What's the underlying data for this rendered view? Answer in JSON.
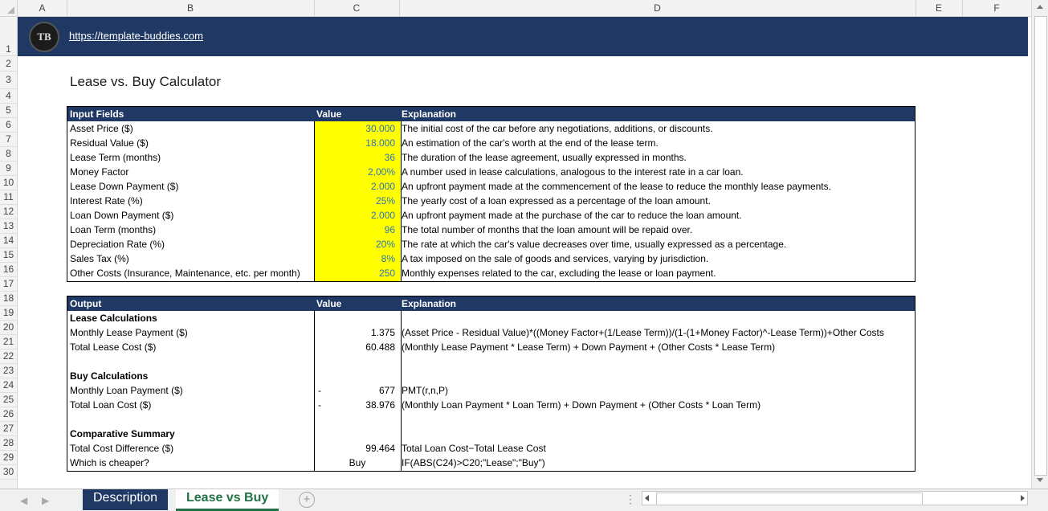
{
  "columns": [
    "A",
    "B",
    "C",
    "D",
    "E",
    "F"
  ],
  "rows": [
    "1",
    "2",
    "3",
    "4",
    "5",
    "6",
    "7",
    "8",
    "9",
    "10",
    "11",
    "12",
    "13",
    "14",
    "15",
    "16",
    "17",
    "18",
    "19",
    "20",
    "21",
    "22",
    "23",
    "24",
    "25",
    "26",
    "27",
    "28",
    "29",
    "30"
  ],
  "header": {
    "logo_text": "TB",
    "link": "https://template-buddies.com"
  },
  "title": "Lease vs. Buy Calculator",
  "input_table": {
    "headers": [
      "Input Fields",
      "Value",
      "Explanation"
    ],
    "rows": [
      {
        "field": "Asset Price ($)",
        "value": "30.000",
        "explanation": "The initial cost of the car before any negotiations, additions, or discounts."
      },
      {
        "field": "Residual Value ($)",
        "value": "18.000",
        "explanation": "An estimation of the car's worth at the end of the lease term."
      },
      {
        "field": "Lease Term (months)",
        "value": "36",
        "explanation": "The duration of the lease agreement, usually expressed in months."
      },
      {
        "field": "Money Factor",
        "value": "2,00%",
        "explanation": "A number used in lease calculations, analogous to the interest rate in a car loan."
      },
      {
        "field": "Lease Down Payment ($)",
        "value": "2.000",
        "explanation": "An upfront payment made at the commencement of the lease to reduce the monthly lease payments."
      },
      {
        "field": "Interest Rate (%)",
        "value": "25%",
        "explanation": "The yearly cost of a loan expressed as a percentage of the loan amount."
      },
      {
        "field": "Loan Down Payment ($)",
        "value": "2.000",
        "explanation": "An upfront payment made at the purchase of the car to reduce the loan amount."
      },
      {
        "field": "Loan Term (months)",
        "value": "96",
        "explanation": "The total number of months that the loan amount will be repaid over."
      },
      {
        "field": "Depreciation Rate (%)",
        "value": "20%",
        "explanation": "The rate at which the car's value decreases over time, usually expressed as a percentage."
      },
      {
        "field": "Sales Tax (%)",
        "value": "8%",
        "explanation": "A tax imposed on the sale of goods and services, varying by jurisdiction."
      },
      {
        "field": "Other Costs (Insurance, Maintenance, etc. per month)",
        "value": "250",
        "explanation": "Monthly expenses related to the car, excluding the lease or loan payment."
      }
    ]
  },
  "output_table": {
    "headers": [
      "Output",
      "Value",
      "Explanation"
    ],
    "rows": [
      {
        "field": "Lease Calculations",
        "bold": true,
        "value": "",
        "sign": "",
        "explanation": ""
      },
      {
        "field": "Monthly Lease Payment ($)",
        "value": "1.375",
        "sign": "",
        "explanation": "(Asset Price - Residual Value)*((Money Factor+(1/Lease Term))/(1-(1+Money Factor)^-Lease Term))+Other Costs"
      },
      {
        "field": "Total Lease Cost ($)",
        "value": "60.488",
        "sign": "",
        "explanation": "(Monthly Lease Payment * Lease Term) + Down Payment + (Other Costs * Lease Term)"
      },
      {
        "field": "",
        "value": "",
        "sign": "",
        "explanation": ""
      },
      {
        "field": "Buy Calculations",
        "bold": true,
        "value": "",
        "sign": "",
        "explanation": ""
      },
      {
        "field": "Monthly Loan Payment ($)",
        "value": "677",
        "sign": "-",
        "explanation": "PMT(r,n,P)"
      },
      {
        "field": "Total Loan Cost ($)",
        "value": "38.976",
        "sign": "-",
        "explanation": "(Monthly Loan Payment * Loan Term) + Down Payment + (Other Costs * Loan Term)"
      },
      {
        "field": "",
        "value": "",
        "sign": "",
        "explanation": ""
      },
      {
        "field": "Comparative Summary",
        "bold": true,
        "value": "",
        "sign": "",
        "explanation": ""
      },
      {
        "field": "Total Cost Difference ($)",
        "value": "99.464",
        "sign": "",
        "explanation": "Total Loan Cost−Total Lease Cost"
      },
      {
        "field": "Which is cheaper?",
        "value": "Buy",
        "center": true,
        "sign": "",
        "explanation": "IF(ABS(C24)>C20;\"Lease\";\"Buy\")"
      }
    ]
  },
  "tabs": [
    {
      "label": "Description",
      "active": false
    },
    {
      "label": "Lease vs Buy",
      "active": true
    }
  ],
  "colors": {
    "banner": "#203864",
    "input_value": "#2e75b6",
    "input_highlight": "#ffff00",
    "active_tab_text": "#217346"
  }
}
